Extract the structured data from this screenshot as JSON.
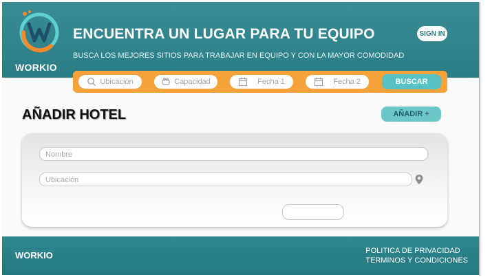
{
  "header": {
    "brand": "WORKIO",
    "title": "ENCUENTRA UN LUGAR PARA TU EQUIPO",
    "subtitle": "BUSCA LOS MEJORES SITIOS PARA TRABAJAR EN EQUIPO Y CON LA MAYOR COMODIDAD",
    "signin_label": "SIGN IN"
  },
  "search": {
    "location_placeholder": "Ubicación",
    "capacity_placeholder": "Capacidad",
    "date1_placeholder": "Fecha 1",
    "date2_placeholder": "Fecha 2",
    "search_label": "BUSCAR"
  },
  "main": {
    "title": "AÑADIR HOTEL",
    "add_label": "AÑADIR +",
    "form": {
      "name_placeholder": "Nombre",
      "location_placeholder": "Ubicación"
    }
  },
  "footer": {
    "brand": "WORKIO",
    "privacy": "POLITICA DE PRIVACIDAD",
    "terms": "TERMINOS Y CONDICIONES"
  },
  "colors": {
    "teal": "#2a7d85",
    "orange": "#f6a23a",
    "accent": "#57c1c3"
  },
  "icons": [
    "workio-logo",
    "search-icon",
    "capacity-icon",
    "calendar-icon",
    "location-pin-icon"
  ]
}
